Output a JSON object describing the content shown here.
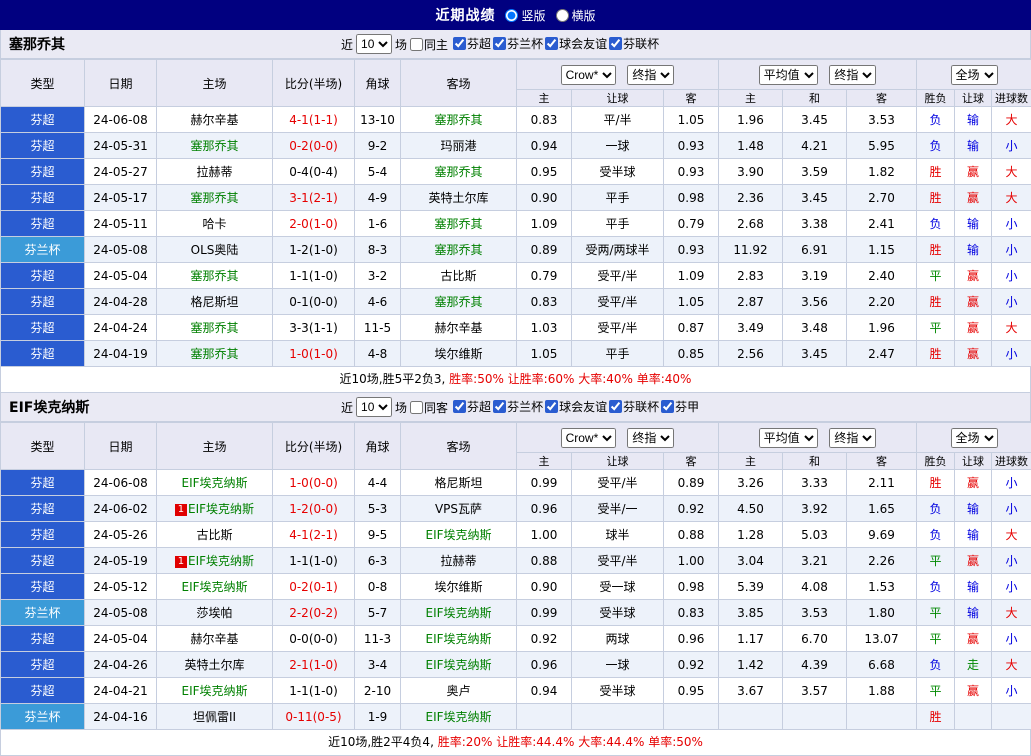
{
  "titlebar": {
    "title": "近期战绩",
    "radio_vertical": "竖版",
    "radio_horizontal": "横版"
  },
  "colors": {
    "titlebar_bg": "#010080",
    "league_super_bg": "#2A5CD0",
    "league_cup_bg": "#3B9BD8",
    "team_highlight": "#008000",
    "win_red": "#E60000",
    "loss_blue": "#0000E0",
    "draw_green": "#008800",
    "alt_row_bg": "#EDF2FA",
    "header_bg": "#E8E8F4"
  },
  "table_header": {
    "near_label": "近",
    "count": "10",
    "games_label": "场",
    "col_type": "类型",
    "col_date": "日期",
    "col_home": "主场",
    "col_score": "比分(半场)",
    "col_corner": "角球",
    "col_away": "客场",
    "select_crow": "Crow*",
    "select_final1": "终指",
    "select_avg": "平均值",
    "select_final2": "终指",
    "select_full": "全场",
    "sub_home": "主",
    "sub_handicap": "让球",
    "sub_away": "客",
    "sub_avg_home": "主",
    "sub_avg_draw": "和",
    "sub_avg_away": "客",
    "sub_result": "胜负",
    "sub_handicap2": "让球",
    "sub_goals": "进球数"
  },
  "sections": [
    {
      "team": "塞那乔其",
      "same_label": "同主",
      "same_checked": false,
      "leagues": [
        {
          "label": "芬超",
          "checked": true
        },
        {
          "label": "芬兰杯",
          "checked": true
        },
        {
          "label": "球会友谊",
          "checked": true
        },
        {
          "label": "芬联杯",
          "checked": true
        }
      ],
      "rows": [
        {
          "league": "芬超",
          "lc": "super",
          "date": "24-06-08",
          "home": {
            "name": "赫尔辛基",
            "hl": false
          },
          "score": {
            "text": "4-1(1-1)",
            "color": "red"
          },
          "corner": "13-10",
          "away": {
            "name": "塞那乔其",
            "hl": true
          },
          "odds": [
            "0.83",
            "平/半",
            "1.05"
          ],
          "avg": [
            "1.96",
            "3.45",
            "3.53"
          ],
          "res": [
            {
              "t": "负",
              "c": "blue"
            },
            {
              "t": "输",
              "c": "blue"
            },
            {
              "t": "大",
              "c": "red"
            }
          ]
        },
        {
          "league": "芬超",
          "lc": "super",
          "date": "24-05-31",
          "home": {
            "name": "塞那乔其",
            "hl": true
          },
          "score": {
            "text": "0-2(0-0)",
            "color": "red"
          },
          "corner": "9-2",
          "away": {
            "name": "玛丽港",
            "hl": false
          },
          "odds": [
            "0.94",
            "一球",
            "0.93"
          ],
          "avg": [
            "1.48",
            "4.21",
            "5.95"
          ],
          "res": [
            {
              "t": "负",
              "c": "blue"
            },
            {
              "t": "输",
              "c": "blue"
            },
            {
              "t": "小",
              "c": "blue"
            }
          ]
        },
        {
          "league": "芬超",
          "lc": "super",
          "date": "24-05-27",
          "home": {
            "name": "拉赫蒂",
            "hl": false
          },
          "score": {
            "text": "0-4(0-4)",
            "color": "black"
          },
          "corner": "5-4",
          "away": {
            "name": "塞那乔其",
            "hl": true
          },
          "odds": [
            "0.95",
            "受半球",
            "0.93"
          ],
          "avg": [
            "3.90",
            "3.59",
            "1.82"
          ],
          "res": [
            {
              "t": "胜",
              "c": "red"
            },
            {
              "t": "赢",
              "c": "red"
            },
            {
              "t": "大",
              "c": "red"
            }
          ]
        },
        {
          "league": "芬超",
          "lc": "super",
          "date": "24-05-17",
          "home": {
            "name": "塞那乔其",
            "hl": true
          },
          "score": {
            "text": "3-1(2-1)",
            "color": "red"
          },
          "corner": "4-9",
          "away": {
            "name": "英特土尔库",
            "hl": false
          },
          "odds": [
            "0.90",
            "平手",
            "0.98"
          ],
          "avg": [
            "2.36",
            "3.45",
            "2.70"
          ],
          "res": [
            {
              "t": "胜",
              "c": "red"
            },
            {
              "t": "赢",
              "c": "red"
            },
            {
              "t": "大",
              "c": "red"
            }
          ]
        },
        {
          "league": "芬超",
          "lc": "super",
          "date": "24-05-11",
          "home": {
            "name": "哈卡",
            "hl": false
          },
          "score": {
            "text": "2-0(1-0)",
            "color": "red"
          },
          "corner": "1-6",
          "away": {
            "name": "塞那乔其",
            "hl": true
          },
          "odds": [
            "1.09",
            "平手",
            "0.79"
          ],
          "avg": [
            "2.68",
            "3.38",
            "2.41"
          ],
          "res": [
            {
              "t": "负",
              "c": "blue"
            },
            {
              "t": "输",
              "c": "blue"
            },
            {
              "t": "小",
              "c": "blue"
            }
          ]
        },
        {
          "league": "芬兰杯",
          "lc": "cup",
          "date": "24-05-08",
          "home": {
            "name": "OLS奥陆",
            "hl": false
          },
          "score": {
            "text": "1-2(1-0)",
            "color": "black"
          },
          "corner": "8-3",
          "away": {
            "name": "塞那乔其",
            "hl": true
          },
          "odds": [
            "0.89",
            "受两/两球半",
            "0.93"
          ],
          "avg": [
            "11.92",
            "6.91",
            "1.15"
          ],
          "res": [
            {
              "t": "胜",
              "c": "red"
            },
            {
              "t": "输",
              "c": "blue"
            },
            {
              "t": "小",
              "c": "blue"
            }
          ]
        },
        {
          "league": "芬超",
          "lc": "super",
          "date": "24-05-04",
          "home": {
            "name": "塞那乔其",
            "hl": true
          },
          "score": {
            "text": "1-1(1-0)",
            "color": "black"
          },
          "corner": "3-2",
          "away": {
            "name": "古比斯",
            "hl": false
          },
          "odds": [
            "0.79",
            "受平/半",
            "1.09"
          ],
          "avg": [
            "2.83",
            "3.19",
            "2.40"
          ],
          "res": [
            {
              "t": "平",
              "c": "green"
            },
            {
              "t": "赢",
              "c": "red"
            },
            {
              "t": "小",
              "c": "blue"
            }
          ]
        },
        {
          "league": "芬超",
          "lc": "super",
          "date": "24-04-28",
          "home": {
            "name": "格尼斯坦",
            "hl": false
          },
          "score": {
            "text": "0-1(0-0)",
            "color": "black"
          },
          "corner": "4-6",
          "away": {
            "name": "塞那乔其",
            "hl": true
          },
          "odds": [
            "0.83",
            "受平/半",
            "1.05"
          ],
          "avg": [
            "2.87",
            "3.56",
            "2.20"
          ],
          "res": [
            {
              "t": "胜",
              "c": "red"
            },
            {
              "t": "赢",
              "c": "red"
            },
            {
              "t": "小",
              "c": "blue"
            }
          ]
        },
        {
          "league": "芬超",
          "lc": "super",
          "date": "24-04-24",
          "home": {
            "name": "塞那乔其",
            "hl": true
          },
          "score": {
            "text": "3-3(1-1)",
            "color": "black"
          },
          "corner": "11-5",
          "away": {
            "name": "赫尔辛基",
            "hl": false
          },
          "odds": [
            "1.03",
            "受平/半",
            "0.87"
          ],
          "avg": [
            "3.49",
            "3.48",
            "1.96"
          ],
          "res": [
            {
              "t": "平",
              "c": "green"
            },
            {
              "t": "赢",
              "c": "red"
            },
            {
              "t": "大",
              "c": "red"
            }
          ]
        },
        {
          "league": "芬超",
          "lc": "super",
          "date": "24-04-19",
          "home": {
            "name": "塞那乔其",
            "hl": true
          },
          "score": {
            "text": "1-0(1-0)",
            "color": "red"
          },
          "corner": "4-8",
          "away": {
            "name": "埃尔维斯",
            "hl": false
          },
          "odds": [
            "1.05",
            "平手",
            "0.85"
          ],
          "avg": [
            "2.56",
            "3.45",
            "2.47"
          ],
          "res": [
            {
              "t": "胜",
              "c": "red"
            },
            {
              "t": "赢",
              "c": "red"
            },
            {
              "t": "小",
              "c": "blue"
            }
          ]
        }
      ],
      "summary_prefix": "近10场,胜5平2负3, ",
      "summary_stats": "胜率:50% 让胜率:60% 大率:40% 单率:40%"
    },
    {
      "team": "EIF埃克纳斯",
      "same_label": "同客",
      "same_checked": false,
      "leagues": [
        {
          "label": "芬超",
          "checked": true
        },
        {
          "label": "芬兰杯",
          "checked": true
        },
        {
          "label": "球会友谊",
          "checked": true
        },
        {
          "label": "芬联杯",
          "checked": true
        },
        {
          "label": "芬甲",
          "checked": true
        }
      ],
      "rows": [
        {
          "league": "芬超",
          "lc": "super",
          "date": "24-06-08",
          "home": {
            "name": "EIF埃克纳斯",
            "hl": true
          },
          "score": {
            "text": "1-0(0-0)",
            "color": "red"
          },
          "corner": "4-4",
          "away": {
            "name": "格尼斯坦",
            "hl": false
          },
          "odds": [
            "0.99",
            "受平/半",
            "0.89"
          ],
          "avg": [
            "3.26",
            "3.33",
            "2.11"
          ],
          "res": [
            {
              "t": "胜",
              "c": "red"
            },
            {
              "t": "赢",
              "c": "red"
            },
            {
              "t": "小",
              "c": "blue"
            }
          ]
        },
        {
          "league": "芬超",
          "lc": "super",
          "date": "24-06-02",
          "home": {
            "name": "EIF埃克纳斯",
            "hl": true,
            "badge": "1"
          },
          "score": {
            "text": "1-2(0-0)",
            "color": "red"
          },
          "corner": "5-3",
          "away": {
            "name": "VPS瓦萨",
            "hl": false
          },
          "odds": [
            "0.96",
            "受半/一",
            "0.92"
          ],
          "avg": [
            "4.50",
            "3.92",
            "1.65"
          ],
          "res": [
            {
              "t": "负",
              "c": "blue"
            },
            {
              "t": "输",
              "c": "blue"
            },
            {
              "t": "小",
              "c": "blue"
            }
          ]
        },
        {
          "league": "芬超",
          "lc": "super",
          "date": "24-05-26",
          "home": {
            "name": "古比斯",
            "hl": false
          },
          "score": {
            "text": "4-1(2-1)",
            "color": "red"
          },
          "corner": "9-5",
          "away": {
            "name": "EIF埃克纳斯",
            "hl": true
          },
          "odds": [
            "1.00",
            "球半",
            "0.88"
          ],
          "avg": [
            "1.28",
            "5.03",
            "9.69"
          ],
          "res": [
            {
              "t": "负",
              "c": "blue"
            },
            {
              "t": "输",
              "c": "blue"
            },
            {
              "t": "大",
              "c": "red"
            }
          ]
        },
        {
          "league": "芬超",
          "lc": "super",
          "date": "24-05-19",
          "home": {
            "name": "EIF埃克纳斯",
            "hl": true,
            "badge": "1"
          },
          "score": {
            "text": "1-1(1-0)",
            "color": "black"
          },
          "corner": "6-3",
          "away": {
            "name": "拉赫蒂",
            "hl": false
          },
          "odds": [
            "0.88",
            "受平/半",
            "1.00"
          ],
          "avg": [
            "3.04",
            "3.21",
            "2.26"
          ],
          "res": [
            {
              "t": "平",
              "c": "green"
            },
            {
              "t": "赢",
              "c": "red"
            },
            {
              "t": "小",
              "c": "blue"
            }
          ]
        },
        {
          "league": "芬超",
          "lc": "super",
          "date": "24-05-12",
          "home": {
            "name": "EIF埃克纳斯",
            "hl": true
          },
          "score": {
            "text": "0-2(0-1)",
            "color": "red"
          },
          "corner": "0-8",
          "away": {
            "name": "埃尔维斯",
            "hl": false
          },
          "odds": [
            "0.90",
            "受一球",
            "0.98"
          ],
          "avg": [
            "5.39",
            "4.08",
            "1.53"
          ],
          "res": [
            {
              "t": "负",
              "c": "blue"
            },
            {
              "t": "输",
              "c": "blue"
            },
            {
              "t": "小",
              "c": "blue"
            }
          ]
        },
        {
          "league": "芬兰杯",
          "lc": "cup",
          "date": "24-05-08",
          "home": {
            "name": "莎埃帕",
            "hl": false
          },
          "score": {
            "text": "2-2(0-2)",
            "color": "red"
          },
          "corner": "5-7",
          "away": {
            "name": "EIF埃克纳斯",
            "hl": true
          },
          "odds": [
            "0.99",
            "受半球",
            "0.83"
          ],
          "avg": [
            "3.85",
            "3.53",
            "1.80"
          ],
          "res": [
            {
              "t": "平",
              "c": "green"
            },
            {
              "t": "输",
              "c": "blue"
            },
            {
              "t": "大",
              "c": "red"
            }
          ]
        },
        {
          "league": "芬超",
          "lc": "super",
          "date": "24-05-04",
          "home": {
            "name": "赫尔辛基",
            "hl": false
          },
          "score": {
            "text": "0-0(0-0)",
            "color": "black"
          },
          "corner": "11-3",
          "away": {
            "name": "EIF埃克纳斯",
            "hl": true
          },
          "odds": [
            "0.92",
            "两球",
            "0.96"
          ],
          "avg": [
            "1.17",
            "6.70",
            "13.07"
          ],
          "res": [
            {
              "t": "平",
              "c": "green"
            },
            {
              "t": "赢",
              "c": "red"
            },
            {
              "t": "小",
              "c": "blue"
            }
          ]
        },
        {
          "league": "芬超",
          "lc": "super",
          "date": "24-04-26",
          "home": {
            "name": "英特土尔库",
            "hl": false
          },
          "score": {
            "text": "2-1(1-0)",
            "color": "red"
          },
          "corner": "3-4",
          "away": {
            "name": "EIF埃克纳斯",
            "hl": true
          },
          "odds": [
            "0.96",
            "一球",
            "0.92"
          ],
          "avg": [
            "1.42",
            "4.39",
            "6.68"
          ],
          "res": [
            {
              "t": "负",
              "c": "blue"
            },
            {
              "t": "走",
              "c": "green"
            },
            {
              "t": "大",
              "c": "red"
            }
          ]
        },
        {
          "league": "芬超",
          "lc": "super",
          "date": "24-04-21",
          "home": {
            "name": "EIF埃克纳斯",
            "hl": true
          },
          "score": {
            "text": "1-1(1-0)",
            "color": "black"
          },
          "corner": "2-10",
          "away": {
            "name": "奥卢",
            "hl": false
          },
          "odds": [
            "0.94",
            "受半球",
            "0.95"
          ],
          "avg": [
            "3.67",
            "3.57",
            "1.88"
          ],
          "res": [
            {
              "t": "平",
              "c": "green"
            },
            {
              "t": "赢",
              "c": "red"
            },
            {
              "t": "小",
              "c": "blue"
            }
          ]
        },
        {
          "league": "芬兰杯",
          "lc": "cup",
          "date": "24-04-16",
          "home": {
            "name": "坦佩雷II",
            "hl": false
          },
          "score": {
            "text": "0-11(0-5)",
            "color": "red"
          },
          "corner": "1-9",
          "away": {
            "name": "EIF埃克纳斯",
            "hl": true
          },
          "odds": [
            "",
            "",
            ""
          ],
          "avg": [
            "",
            "",
            ""
          ],
          "res": [
            {
              "t": "胜",
              "c": "red"
            },
            {
              "t": "",
              "c": "black"
            },
            {
              "t": "",
              "c": "black"
            }
          ]
        }
      ],
      "summary_prefix": "近10场,胜2平4负4, ",
      "summary_stats": "胜率:20% 让胜率:44.4% 大率:44.4% 单率:50%"
    }
  ]
}
